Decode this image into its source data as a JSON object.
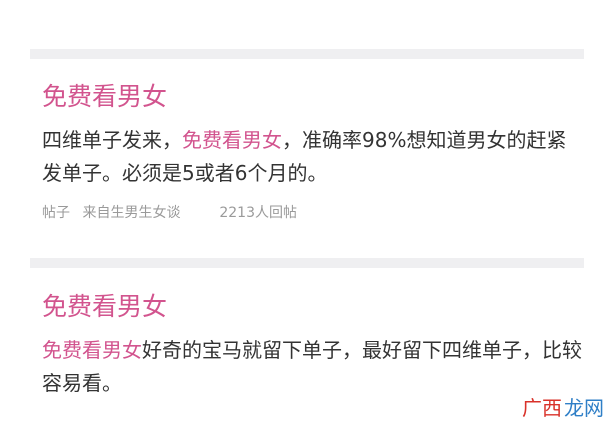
{
  "post1": {
    "title": "免费看男女",
    "body_start": "四维单子发来，",
    "body_highlight": "免费看男女",
    "body_rest": "，准确率98%想知道男女的赶紧发单子。必须是5或者6个月的。",
    "meta_type": "帖子",
    "meta_source": "来自生男生女谈",
    "meta_replies": "2213人回帖"
  },
  "post2": {
    "title": "免费看男女",
    "body_highlight": "免费看男女",
    "body_rest": "好奇的宝马就留下单子，最好留下四维单子，比较容易看。"
  },
  "watermark": {
    "part1": "广西",
    "part2": "龙网"
  },
  "colors": {
    "accent": "#d2548e",
    "divider": "#efeff1",
    "meta_text": "#9a9a9a",
    "body_text": "#333333"
  }
}
